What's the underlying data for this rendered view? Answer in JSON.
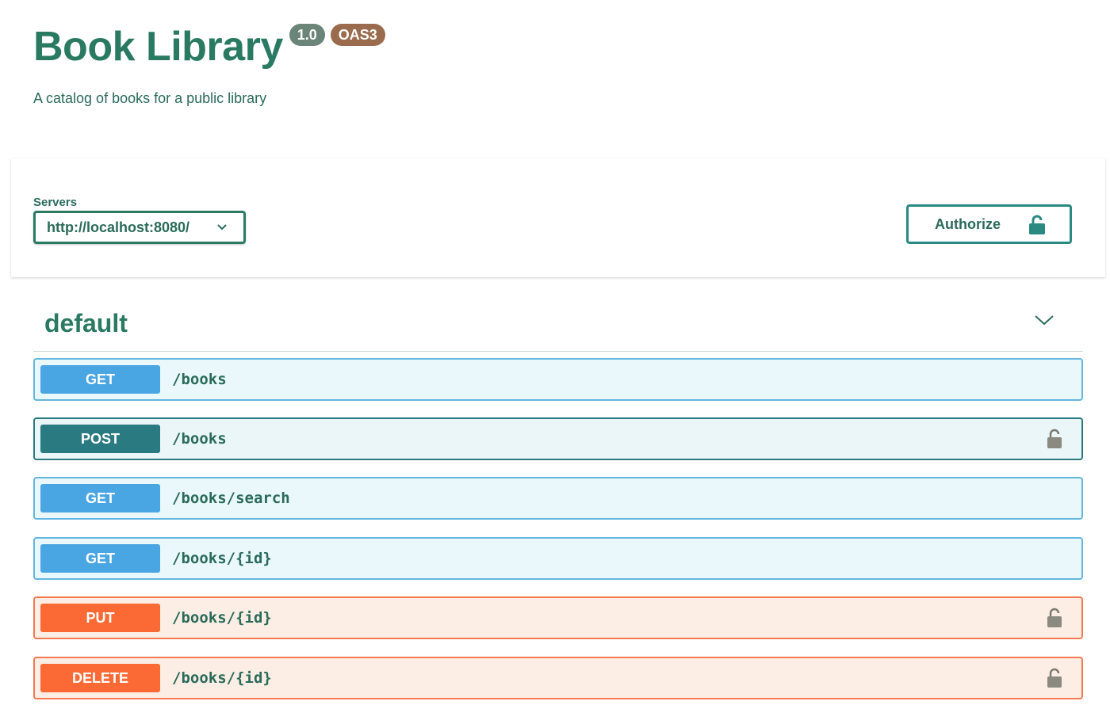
{
  "info": {
    "title": "Book Library",
    "version": "1.0",
    "spec": "OAS3",
    "description": "A catalog of books for a public library"
  },
  "servers": {
    "label": "Servers",
    "selected": "http://localhost:8080/"
  },
  "authorize": {
    "label": "Authorize",
    "icon": "unlock-icon"
  },
  "tag": {
    "name": "default",
    "icon": "chevron-down-icon"
  },
  "operations": [
    {
      "method": "GET",
      "path": "/books",
      "locked": false
    },
    {
      "method": "POST",
      "path": "/books",
      "locked": true
    },
    {
      "method": "GET",
      "path": "/books/search",
      "locked": false
    },
    {
      "method": "GET",
      "path": "/books/{id}",
      "locked": false
    },
    {
      "method": "PUT",
      "path": "/books/{id}",
      "locked": true
    },
    {
      "method": "DELETE",
      "path": "/books/{id}",
      "locked": true
    }
  ],
  "colors": {
    "primary": "#2a7a62",
    "get": "#4aa6e3",
    "post": "#2a7a82",
    "put": "#fb6934",
    "delete": "#fb6934"
  }
}
